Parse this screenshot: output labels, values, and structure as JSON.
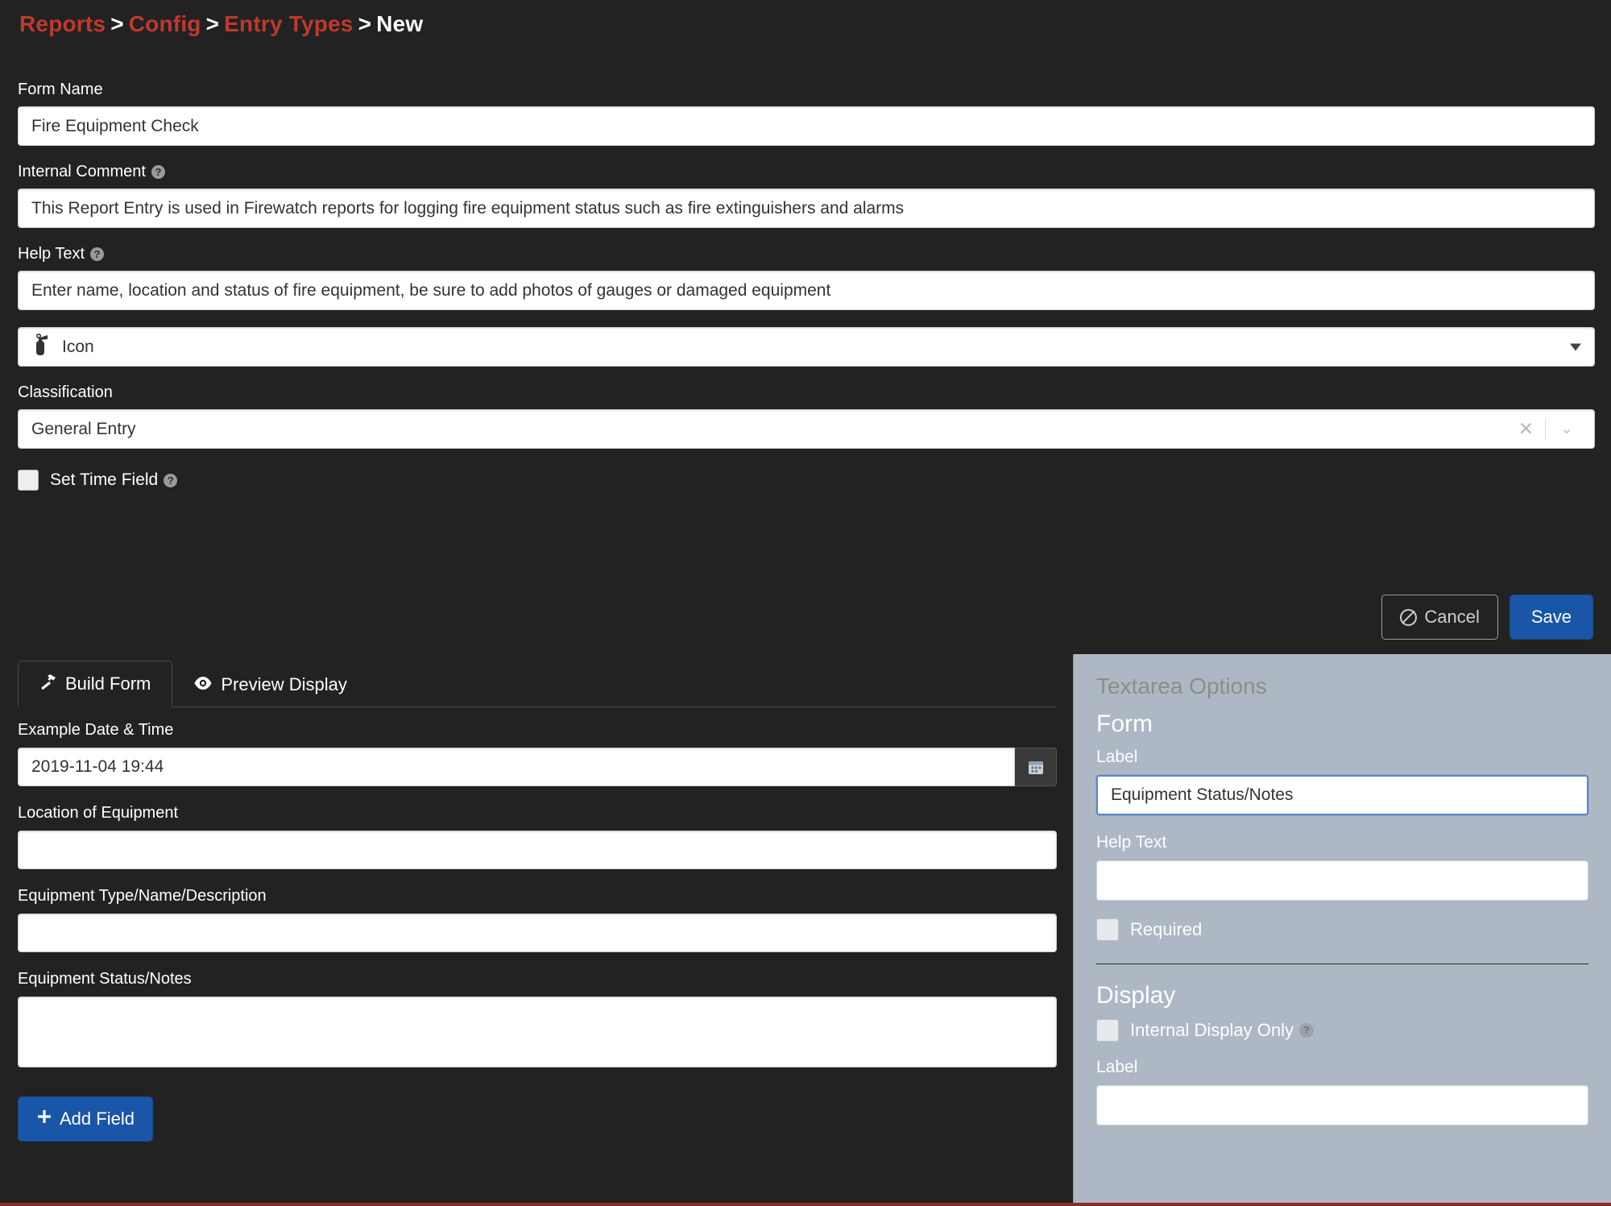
{
  "breadcrumb": {
    "items": [
      "Reports",
      "Config",
      "Entry Types"
    ],
    "current": "New",
    "separator": ">",
    "link_color": "#c0392b"
  },
  "top_form": {
    "form_name": {
      "label": "Form Name",
      "value": "Fire Equipment Check"
    },
    "internal_comment": {
      "label": "Internal Comment",
      "has_help": true,
      "value": "This Report Entry is used in Firewatch reports for logging fire equipment status such as fire extinguishers and alarms"
    },
    "help_text": {
      "label": "Help Text",
      "has_help": true,
      "value": "Enter name, location and status of fire equipment, be sure to add photos of gauges or damaged equipment"
    },
    "icon_select": {
      "value": "Icon",
      "icon": "fire-extinguisher-icon"
    },
    "classification": {
      "label": "Classification",
      "value": "General Entry",
      "clear_glyph": "✕",
      "caret_glyph": "⌄"
    },
    "set_time_field": {
      "label": "Set Time Field",
      "checked": false,
      "has_help": true
    }
  },
  "actions": {
    "cancel_label": "Cancel",
    "save_label": "Save",
    "save_color": "#1a56a8"
  },
  "tabs": [
    {
      "label": "Build Form",
      "icon": "hammer-icon",
      "active": true
    },
    {
      "label": "Preview Display",
      "icon": "eye-icon",
      "active": false
    }
  ],
  "build_form": {
    "fields": [
      {
        "label": "Example Date & Time",
        "value": "2019-11-04 19:44",
        "type": "datetime",
        "icon": "calendar-icon"
      },
      {
        "label": "Location of Equipment",
        "value": "",
        "type": "text"
      },
      {
        "label": "Equipment Type/Name/Description",
        "value": "",
        "type": "text"
      },
      {
        "label": "Equipment Status/Notes",
        "value": "",
        "type": "textarea"
      }
    ],
    "add_field_label": "Add Field",
    "add_field_icon": "plus-icon"
  },
  "options_panel": {
    "title": "Textarea Options",
    "form_section": "Form",
    "form_label_caption": "Label",
    "form_label_value": "Equipment Status/Notes",
    "form_helptext_caption": "Help Text",
    "form_helptext_value": "",
    "required_label": "Required",
    "required_checked": false,
    "display_section": "Display",
    "internal_display_only_label": "Internal Display Only",
    "internal_display_only_checked": false,
    "display_label_caption": "Label",
    "display_label_value": "",
    "panel_bg": "#aeb8c4"
  }
}
